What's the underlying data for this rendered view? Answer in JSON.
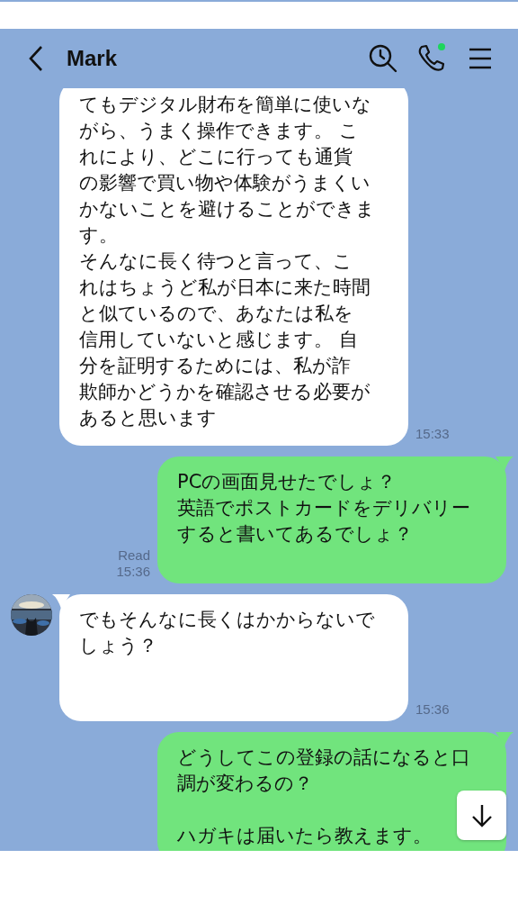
{
  "header": {
    "title": "Mark"
  },
  "messages": [
    {
      "kind": "incoming",
      "tail": false,
      "avatar": false,
      "paragraphs": [
        [
          "てもデジタル財布を簡単に使いな",
          "がら、うまく操作できます。 こ",
          "れにより、どこに行っても通貨",
          "の影響で買い物や体験がうまくい",
          "かないことを避けることができま",
          "す。",
          "そんなに長く待つと言って、こ",
          "れはちょうど私が日本に来た時間",
          "と似ているので、あなたは私を",
          "信用していないと感じます。 自",
          "分を証明するためには、私が詐",
          "欺師かどうかを確認させる必要が",
          "あると思います"
        ]
      ],
      "time": "15:33"
    },
    {
      "kind": "outgoing",
      "tail": true,
      "read": "Read",
      "paragraphs": [
        [
          "PCの画面見せたでしょ？",
          "英語でポストカードをデリバリー",
          "すると書いてあるでしょ？"
        ]
      ],
      "time": "15:36"
    },
    {
      "kind": "incoming",
      "tail": true,
      "avatar": true,
      "paragraphs": [
        [
          "でもそんなに長くはかからないで",
          "しょう？"
        ]
      ],
      "time": "15:36"
    },
    {
      "kind": "outgoing",
      "tail": true,
      "paragraphs": [
        [
          "どうしてこの登録の話になると口",
          "調が変わるの？"
        ],
        [
          "ハガキは届いたら教えます。"
        ]
      ]
    }
  ]
}
